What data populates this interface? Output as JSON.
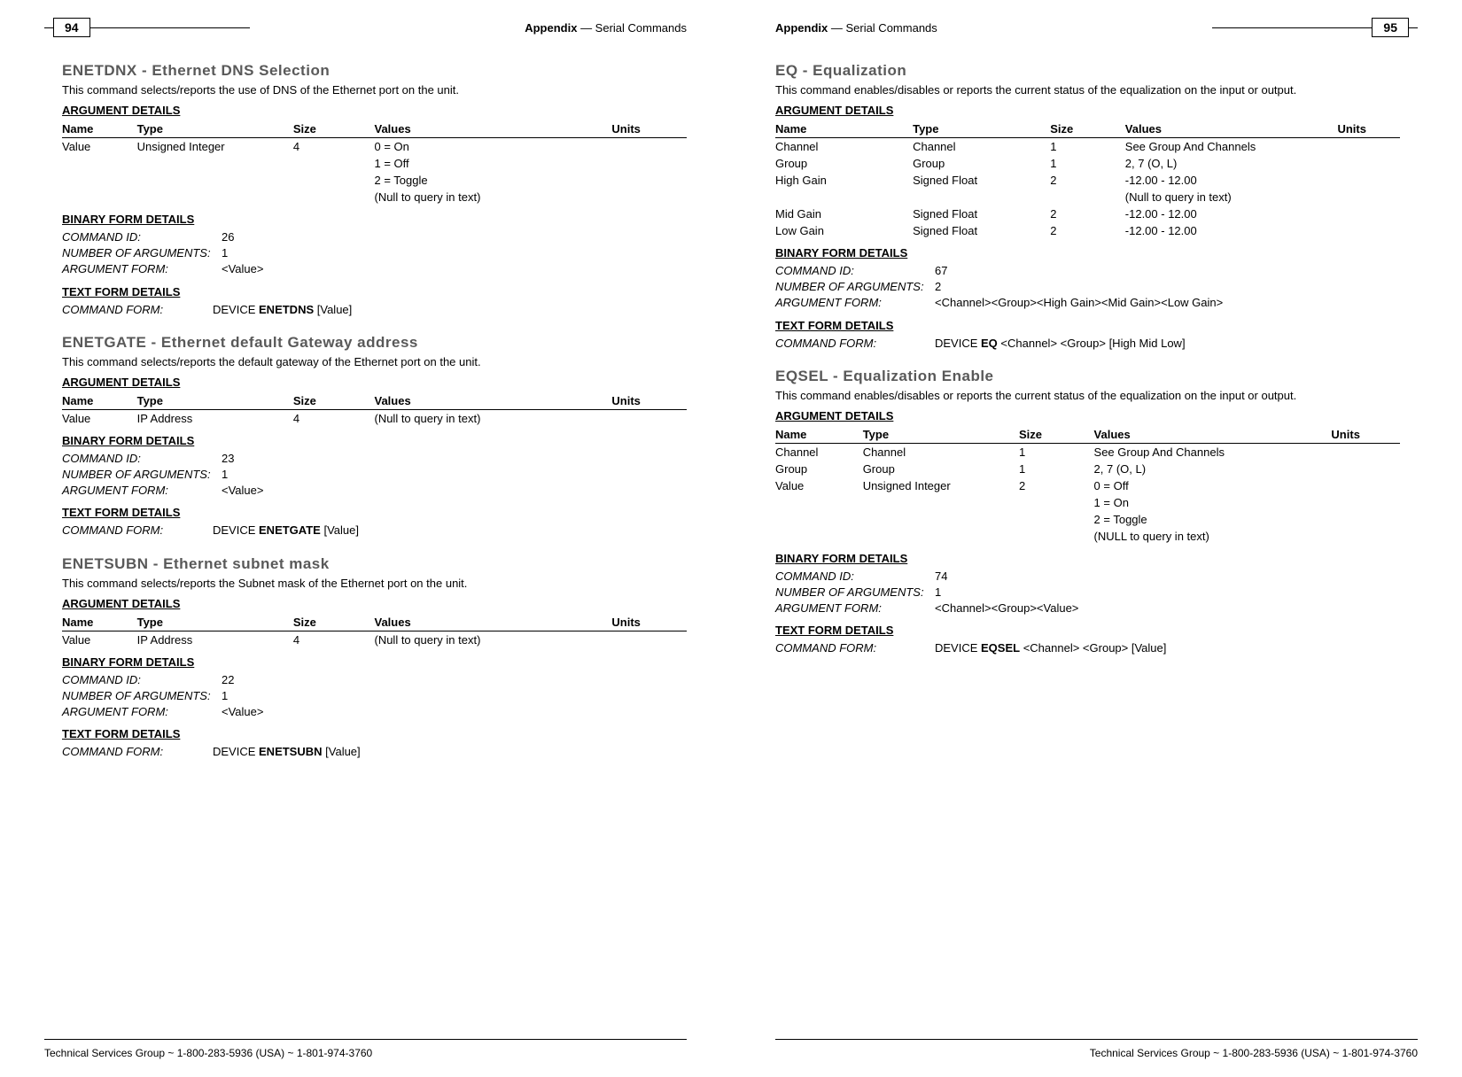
{
  "header": {
    "left_page_num": "94",
    "right_page_num": "95",
    "appendix_bold": "Appendix",
    "appendix_rest": " — Serial Commands"
  },
  "footer": {
    "text": "Technical Services Group ~ 1-800-283-5936 (USA) ~ 1-801-974-3760"
  },
  "arg_headers": {
    "name": "Name",
    "type": "Type",
    "size": "Size",
    "values": "Values",
    "units": "Units"
  },
  "section_labels": {
    "arg_details": "ARGUMENT DETAILS",
    "bin_details": "BINARY FORM DETAILS",
    "text_details": "TEXT FORM DETAILS"
  },
  "kv_labels": {
    "cmd_id": "COMMAND ID:",
    "num_args": "NUMBER OF ARGUMENTS:",
    "arg_form": "ARGUMENT FORM:",
    "cmd_form": "COMMAND FORM:"
  },
  "cmds": {
    "enetdnx": {
      "title": "ENETDNX - Ethernet DNS Selection",
      "desc": "This command selects/reports the use of DNS of the Ethernet port on the unit.",
      "args": [
        {
          "name": "Value",
          "type": "Unsigned Integer",
          "size": "4",
          "values": "0 = On",
          "units": ""
        },
        {
          "name": "",
          "type": "",
          "size": "",
          "values": "1 = Off",
          "units": ""
        },
        {
          "name": "",
          "type": "",
          "size": "",
          "values": "2 = Toggle",
          "units": ""
        },
        {
          "name": "",
          "type": "",
          "size": "",
          "values": "(Null to query in text)",
          "units": ""
        }
      ],
      "cmd_id": "26",
      "num_args": "1",
      "arg_form": "<Value>",
      "cmd_form_pre": "DEVICE ",
      "cmd_form_bold": "ENETDNS",
      "cmd_form_post": " [Value]"
    },
    "enetgate": {
      "title": "ENETGATE - Ethernet default Gateway address",
      "desc": "This command selects/reports the default gateway of the Ethernet port on the unit.",
      "args": [
        {
          "name": "Value",
          "type": "IP Address",
          "size": "4",
          "values": "(Null to query in text)",
          "units": ""
        }
      ],
      "cmd_id": "23",
      "num_args": "1",
      "arg_form": "<Value>",
      "cmd_form_pre": "DEVICE ",
      "cmd_form_bold": "ENETGATE",
      "cmd_form_post": " [Value]"
    },
    "enetsubn": {
      "title": "ENETSUBN - Ethernet subnet mask",
      "desc": "This command selects/reports the Subnet mask of the Ethernet port on the unit.",
      "args": [
        {
          "name": "Value",
          "type": "IP Address",
          "size": "4",
          "values": "(Null to query in text)",
          "units": ""
        }
      ],
      "cmd_id": "22",
      "num_args": "1",
      "arg_form": "<Value>",
      "cmd_form_pre": "DEVICE ",
      "cmd_form_bold": "ENETSUBN",
      "cmd_form_post": " [Value]"
    },
    "eq": {
      "title": "EQ - Equalization",
      "desc": "This command enables/disables or reports the current status of the equalization on the input or output.",
      "args": [
        {
          "name": "Channel",
          "type": "Channel",
          "size": "1",
          "values": "See Group And Channels",
          "units": ""
        },
        {
          "name": "Group",
          "type": "Group",
          "size": "1",
          "values": "2, 7 (O, L)",
          "units": ""
        },
        {
          "name": "High Gain",
          "type": "Signed Float",
          "size": "2",
          "values": "-12.00 - 12.00",
          "units": ""
        },
        {
          "name": "",
          "type": "",
          "size": "",
          "values": "(Null to query in text)",
          "units": ""
        },
        {
          "name": "Mid Gain",
          "type": "Signed Float",
          "size": "2",
          "values": "-12.00 - 12.00",
          "units": ""
        },
        {
          "name": "Low Gain",
          "type": "Signed Float",
          "size": "2",
          "values": "-12.00 - 12.00",
          "units": ""
        }
      ],
      "cmd_id": "67",
      "num_args": "2",
      "arg_form": "<Channel><Group><High Gain><Mid Gain><Low Gain>",
      "cmd_form_pre": "DEVICE ",
      "cmd_form_bold": "EQ",
      "cmd_form_post": " <Channel> <Group> [High Mid Low]"
    },
    "eqsel": {
      "title": "EQSEL - Equalization Enable",
      "desc": "This command enables/disables or reports the current status of the equalization on the input or output.",
      "args": [
        {
          "name": "Channel",
          "type": "Channel",
          "size": "1",
          "values": "See Group And Channels",
          "units": ""
        },
        {
          "name": "Group",
          "type": "Group",
          "size": "1",
          "values": "2, 7 (O, L)",
          "units": ""
        },
        {
          "name": "Value",
          "type": "Unsigned Integer",
          "size": "2",
          "values": "0 = Off",
          "units": ""
        },
        {
          "name": "",
          "type": "",
          "size": "",
          "values": "1 = On",
          "units": ""
        },
        {
          "name": "",
          "type": "",
          "size": "",
          "values": "2 = Toggle",
          "units": ""
        },
        {
          "name": "",
          "type": "",
          "size": "",
          "values": "(NULL to query in text)",
          "units": ""
        }
      ],
      "cmd_id": "74",
      "num_args": "1",
      "arg_form": "<Channel><Group><Value>",
      "cmd_form_pre": "DEVICE ",
      "cmd_form_bold": "EQSEL",
      "cmd_form_post": " <Channel> <Group> [Value]"
    }
  }
}
